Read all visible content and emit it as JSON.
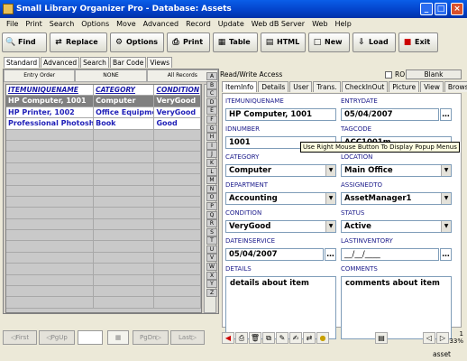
{
  "window": {
    "title": "Small Library Organizer Pro - Database: Assets"
  },
  "menu": [
    "File",
    "Print",
    "Search",
    "Options",
    "Move",
    "Advanced",
    "Record",
    "Update",
    "Web dB Server",
    "Web",
    "Help"
  ],
  "toolbar": {
    "find": "Find",
    "replace": "Replace",
    "options": "Options",
    "print": "Print",
    "table": "Table",
    "html": "HTML",
    "new": "New",
    "load": "Load",
    "exit": "Exit"
  },
  "modetabs": [
    "Standard",
    "Advanced",
    "Search",
    "Bar Code",
    "Views"
  ],
  "order": {
    "entry": "Entry Order",
    "none": "NONE",
    "all": "All Records"
  },
  "grid": {
    "headers": [
      "ITEMUNIQUENAME",
      "CATEGORY",
      "CONDITION"
    ],
    "rows": [
      [
        "HP Computer, 1001",
        "Computer",
        "VeryGood"
      ],
      [
        "HP Printer, 1002",
        "Office Equipme",
        "VeryGood"
      ],
      [
        "Professional Photosho",
        "Book",
        "Good"
      ]
    ]
  },
  "nav": {
    "first": "First",
    "pgup": "PgUp",
    "pgdn": "PgDn",
    "last": "Last"
  },
  "alpha": [
    "A",
    "B",
    "C",
    "D",
    "E",
    "F",
    "G",
    "H",
    "I",
    "J",
    "K",
    "L",
    "M",
    "N",
    "O",
    "P",
    "Q",
    "R",
    "S",
    "T",
    "U",
    "V",
    "W",
    "X",
    "Y",
    "Z"
  ],
  "access": "Read/Write Access",
  "ro_label": "RO",
  "blank_label": "Blank",
  "formtabs": [
    "ItemInfo",
    "Details",
    "User",
    "Trans.",
    "CheckInOut",
    "Picture",
    "View",
    "Browser"
  ],
  "form": {
    "itemuniquename": {
      "label": "ITEMUNIQUENAME",
      "value": "HP Computer, 1001"
    },
    "entrydate": {
      "label": "ENTRYDATE",
      "value": "05/04/2007"
    },
    "idnumber": {
      "label": "IDNUMBER",
      "value": "1001"
    },
    "tagcode": {
      "label": "TAGCODE",
      "value": "ACC1001m"
    },
    "category": {
      "label": "CATEGORY",
      "value": "Computer"
    },
    "location": {
      "label": "LOCATION",
      "value": "Main Office"
    },
    "department": {
      "label": "DEPARTMENT",
      "value": "Accounting"
    },
    "assignedto": {
      "label": "ASSIGNEDTO",
      "value": "AssetManager1"
    },
    "condition": {
      "label": "CONDITION",
      "value": "VeryGood"
    },
    "status": {
      "label": "STATUS",
      "value": "Active"
    },
    "dateinservice": {
      "label": "DATEINSERVICE",
      "value": "05/04/2007"
    },
    "lastinventory": {
      "label": "LASTINVENTORY",
      "value": "__/__/____"
    },
    "details": {
      "label": "DETAILS",
      "value": "details about item"
    },
    "comments": {
      "label": "COMMENTS",
      "value": "comments about item"
    }
  },
  "tooltip": "Use Right Mouse Button To Display Popup Menus",
  "record": {
    "number": "1",
    "percent": "33%"
  },
  "statusbar": {
    "right": "asset"
  }
}
